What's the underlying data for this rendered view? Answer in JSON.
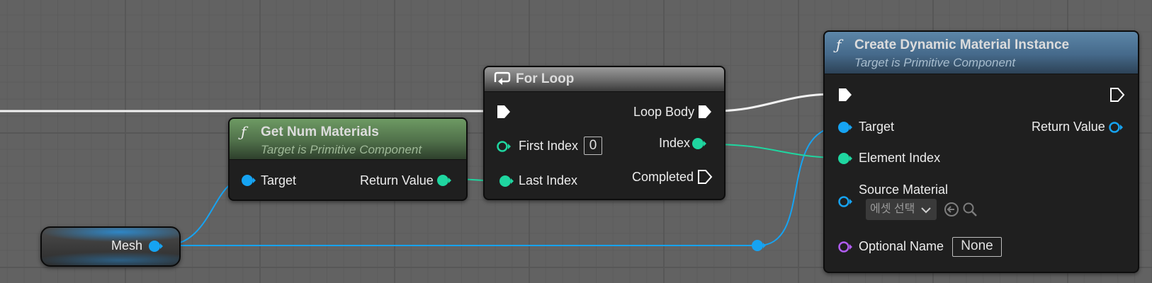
{
  "colors": {
    "object_pin": "#16a3f2",
    "int_pin": "#1fd6a0",
    "name_pin": "#b05cf0",
    "exec_wire": "#ffffff"
  },
  "mesh_node": {
    "label": "Mesh"
  },
  "get_num_materials": {
    "icon": "function-icon",
    "title": "Get Num Materials",
    "subtitle": "Target is Primitive Component",
    "inputs": [
      {
        "label": "Target"
      }
    ],
    "outputs": [
      {
        "label": "Return Value"
      }
    ]
  },
  "for_loop": {
    "icon": "loop-icon",
    "title": "For Loop",
    "inputs": [
      {
        "label": "First Index",
        "default": "0"
      },
      {
        "label": "Last Index"
      }
    ],
    "outputs": [
      {
        "label": "Loop Body"
      },
      {
        "label": "Index"
      },
      {
        "label": "Completed"
      }
    ]
  },
  "create_dmi": {
    "icon": "function-icon",
    "title": "Create Dynamic Material Instance",
    "subtitle": "Target is Primitive Component",
    "inputs": [
      {
        "label": "Target"
      },
      {
        "label": "Element Index"
      },
      {
        "label": "Source Material",
        "asset_placeholder": "에셋 선택"
      },
      {
        "label": "Optional Name",
        "default": "None"
      }
    ],
    "outputs": [
      {
        "label": "Return Value"
      }
    ]
  }
}
